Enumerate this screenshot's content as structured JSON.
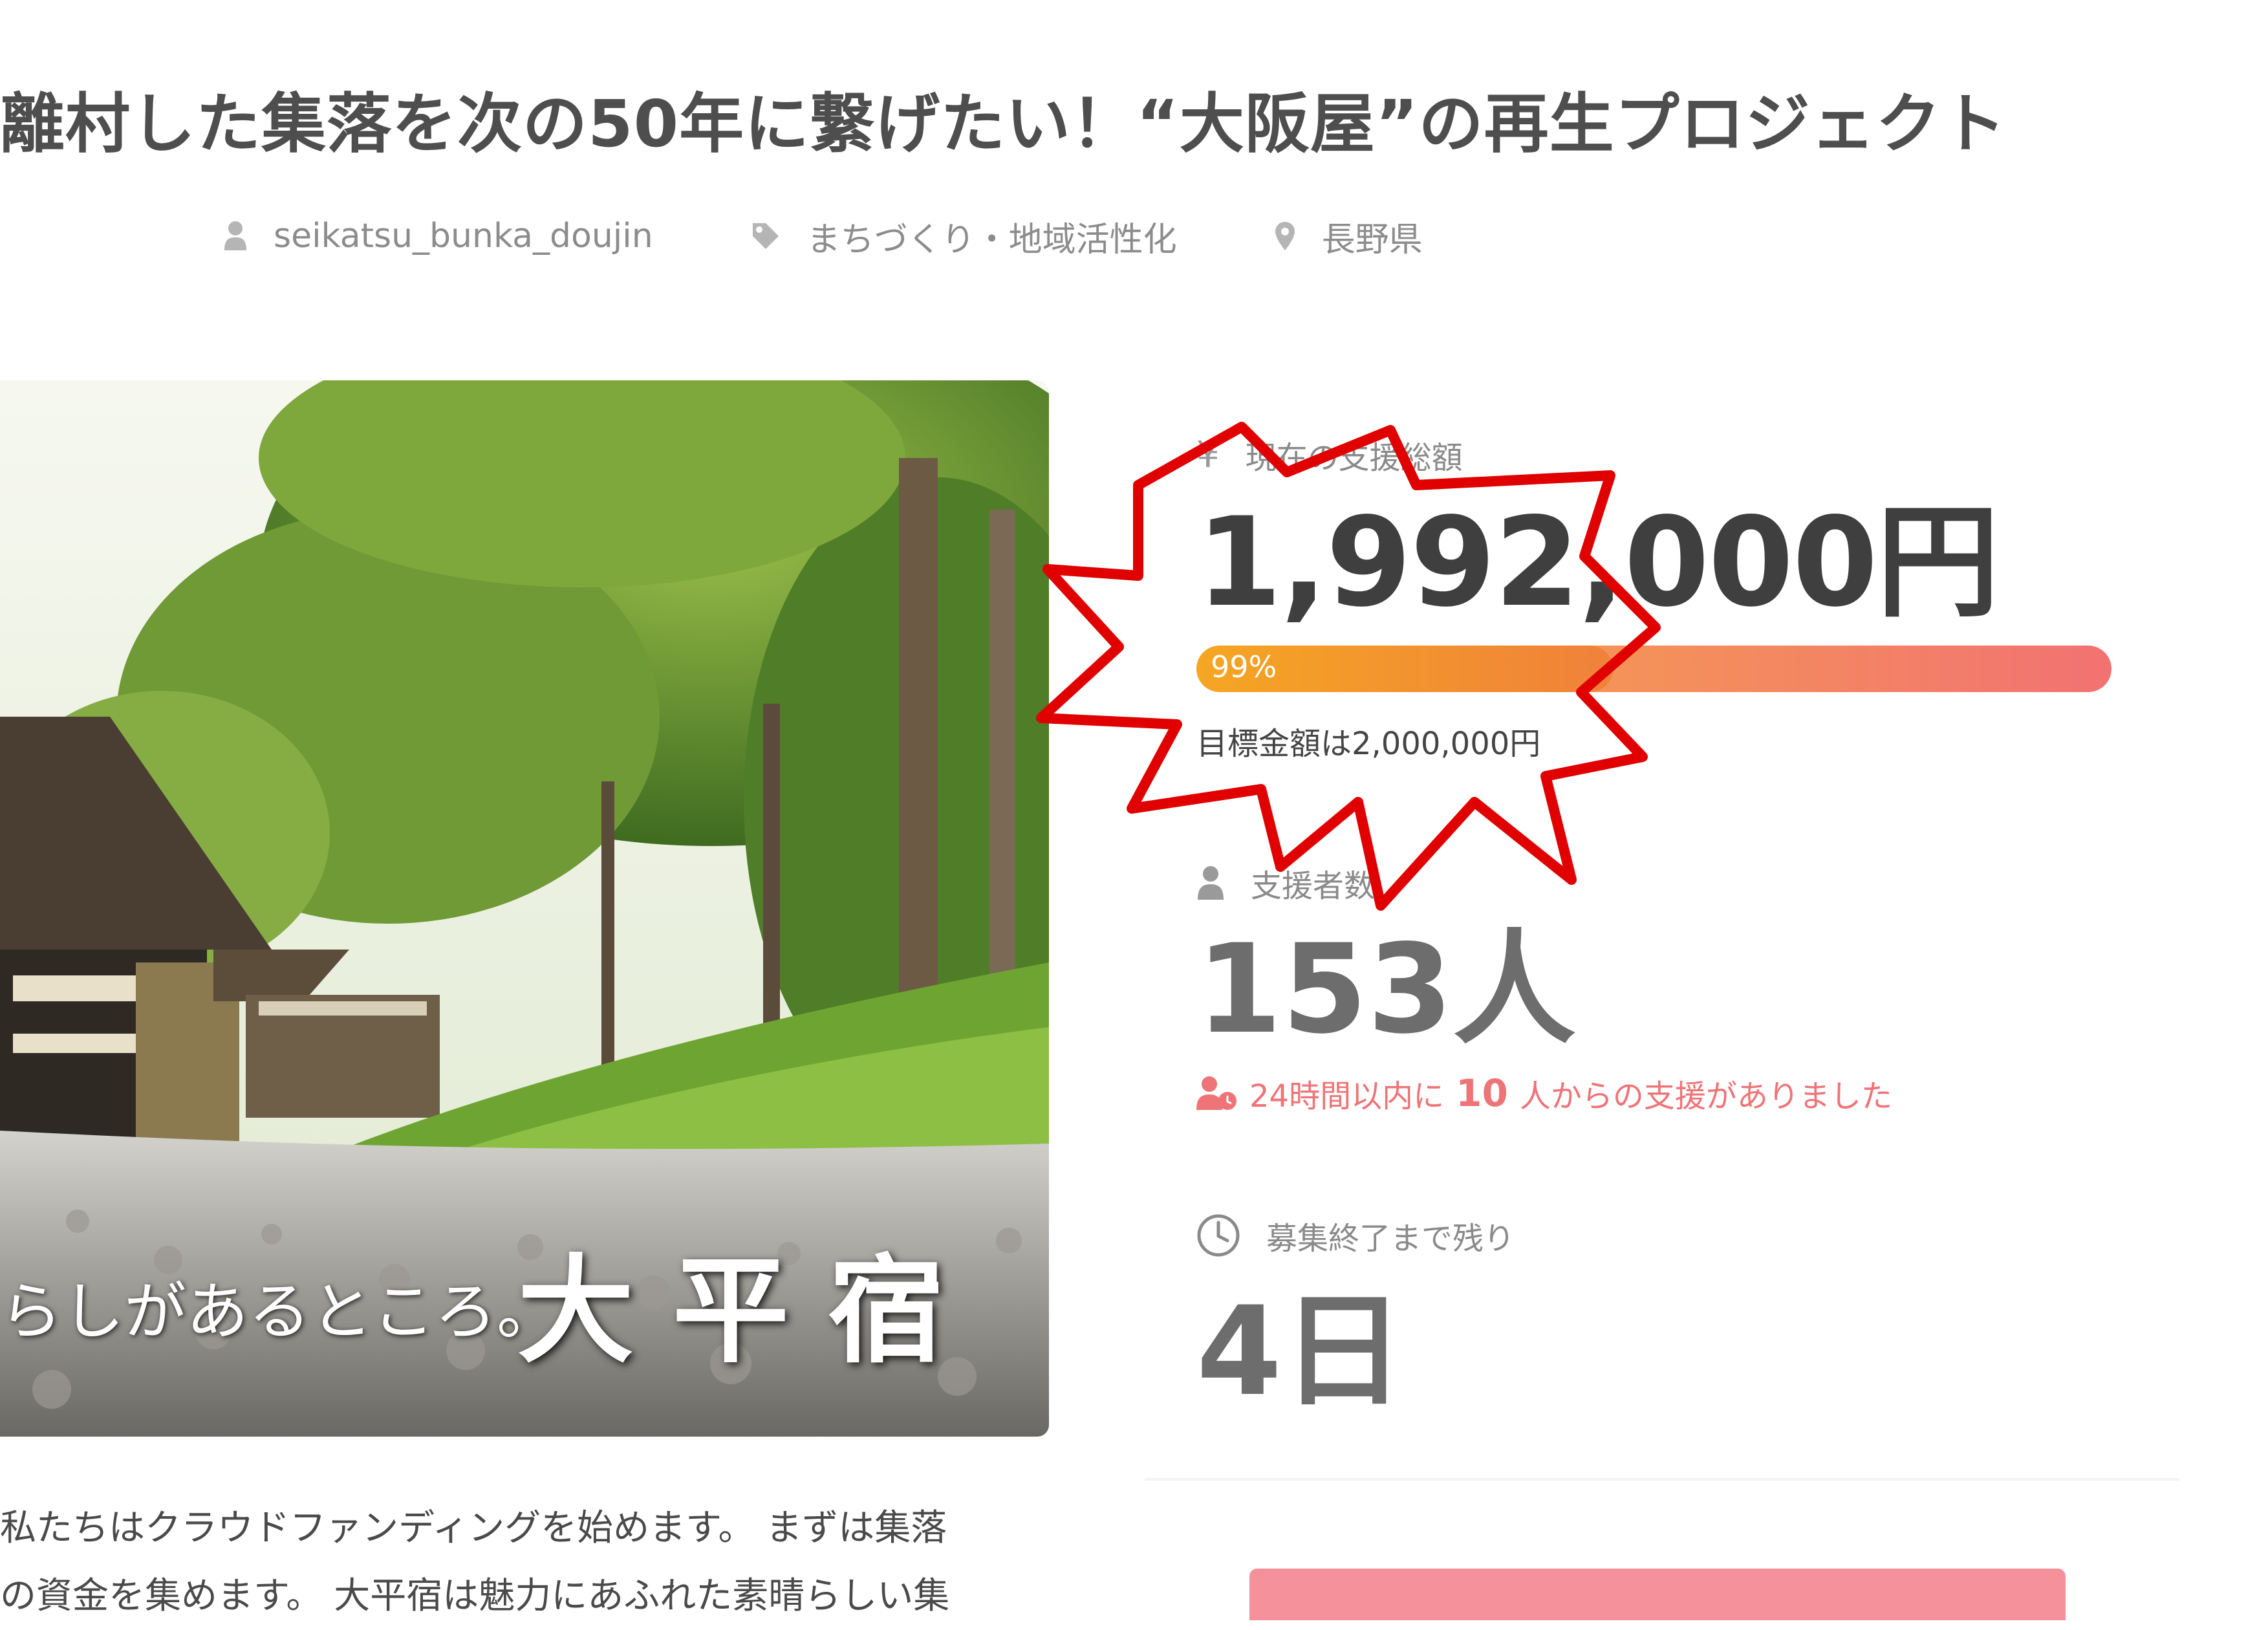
{
  "header": {
    "title": "離村した集落を次の50年に繋げたい！“大阪屋”の再生プロジェクト",
    "author": "seikatsu_bunka_doujin",
    "category": "まちづくり・地域活性化",
    "location": "長野県"
  },
  "hero": {
    "caption": "らしがあるところ。",
    "brand": "大平宿"
  },
  "intro": {
    "line1": "私たちはクラウドファンディングを始めます。 まずは集落",
    "line2": "の資金を集めます。 大平宿は魅力にあふれた素晴らしい集"
  },
  "stats": {
    "amount_label": "現在の支援総額",
    "amount_value": "1,992,000円",
    "progress_fraction": 0.99,
    "progress_label": "99%",
    "goal_text": "目標金額は2,000,000円",
    "backers_label": "支援者数",
    "backers_value": "153人",
    "recent_prefix": "24時間以内に",
    "recent_count": "10",
    "recent_suffix": "人からの支援がありました",
    "remaining_label": "募集終了まで残り",
    "remaining_value": "4日"
  },
  "icons": {
    "currency_glyph": "¥",
    "user": "user-icon",
    "tag": "tag-icon",
    "location": "map-pin-icon",
    "clock": "clock-icon",
    "user_clock": "user-clock-icon"
  },
  "colors": {
    "progress_start": "#f5a623",
    "progress_end": "#f27272",
    "recent_text": "#ee7478",
    "annotation_red": "#e00000",
    "cta": "#f5919a"
  }
}
